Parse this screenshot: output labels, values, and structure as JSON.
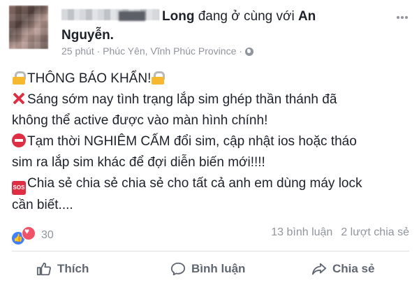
{
  "header": {
    "name_suffix": "Long",
    "with_text": "đang ở cùng với",
    "tagged_first": "An",
    "tagged_second": "Nguyễn.",
    "time": "25 phút",
    "separator": "·",
    "location": "Phúc Yên, Vĩnh Phúc Province",
    "separator2": "·"
  },
  "post": {
    "title": "THÔNG BÁO KHẨN!",
    "line1": "Sáng sớm nay tình trạng lắp sim ghép thần thánh đã",
    "line2": "không thể active được vào màn hình chính!",
    "line3": "Tạm thời NGHIÊM CẤM đổi sim, cập nhật ios hoặc tháo",
    "line4": "sim ra lắp sim khác để đợi diễn biến mới!!!!",
    "line5": "Chia sẻ chia sẻ chia sẻ cho tất cả anh em dùng máy lock",
    "line6": "cần biết....",
    "sos_label": "SOS"
  },
  "engagement": {
    "reaction_count": "30",
    "comments": "13 bình luận",
    "shares": "2 lượt chia sẻ"
  },
  "actions": {
    "like": "Thích",
    "comment": "Bình luận",
    "share": "Chia sẻ"
  }
}
